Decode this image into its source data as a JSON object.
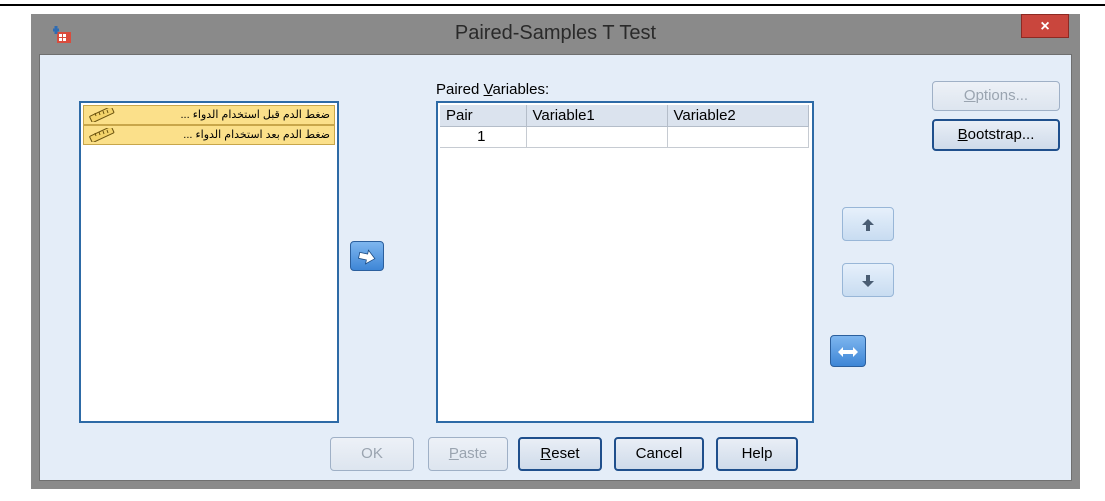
{
  "window": {
    "title": "Paired-Samples T Test",
    "close_label": "×"
  },
  "source_variables": [
    {
      "label": "ضغط الدم قبل استخدام الدواء ..."
    },
    {
      "label": "ضغط الدم بعد استخدام الدواء ..."
    }
  ],
  "paired_variables": {
    "label_prefix": "Paired ",
    "label_underlined": "V",
    "label_suffix": "ariables:",
    "columns": [
      "Pair",
      "Variable1",
      "Variable2"
    ],
    "rows": [
      {
        "pair": "1",
        "variable1": "",
        "variable2": ""
      }
    ]
  },
  "buttons": {
    "options": {
      "underlined": "O",
      "rest": "ptions..."
    },
    "bootstrap": {
      "underlined": "B",
      "rest": "ootstrap..."
    },
    "ok": "OK",
    "paste": {
      "underlined": "P",
      "rest": "aste"
    },
    "reset": {
      "underlined": "R",
      "rest": "eset"
    },
    "cancel": "Cancel",
    "help": "Help"
  },
  "icons": {
    "move_right": "arrow-right-icon",
    "move_up": "arrow-up-icon",
    "move_down": "arrow-down-icon",
    "swap": "swap-horizontal-icon"
  },
  "colors": {
    "window_frame": "#8a8a8a",
    "client_bg": "#e4edf8",
    "list_border": "#2d6aa6",
    "variable_highlight": "#fbe08a",
    "close_button": "#c9463d",
    "arrow_button": "#3e86d6"
  }
}
